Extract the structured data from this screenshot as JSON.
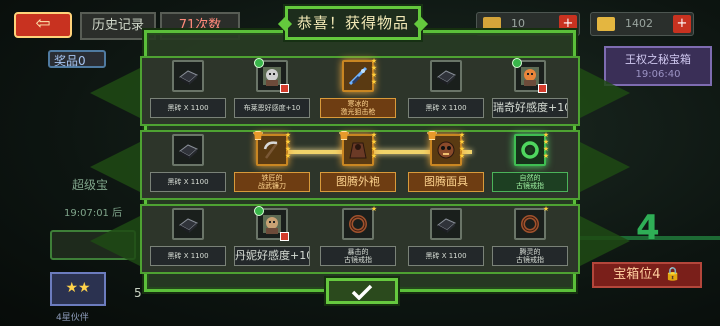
{
  "background": {
    "back_glyph": "⇦",
    "tabs": [
      "历史记录",
      "71次数"
    ],
    "resources": [
      {
        "value": "10",
        "icon": "key-icon",
        "color": "#d4a43a"
      },
      {
        "value": "1402",
        "icon": "gold-bar-icon",
        "color": "#e4b640"
      }
    ],
    "left_labels": [
      "奖品0",
      "超级宝",
      "19:07:01 后"
    ],
    "right_chest_title": "王权之秘宝箱",
    "right_chest_time": "19:06:40",
    "bottom_left_value": "5",
    "bottom_left_caption": "4星伙伴",
    "chest_button": "宝箱位4",
    "big_number": "4"
  },
  "dialog": {
    "title": "恭喜！获得物品",
    "confirm_icon": "checkmark-icon",
    "rows": [
      [
        {
          "label": "黑砖 X 1100",
          "icon": "black-brick-icon",
          "tier": "common",
          "stars": 0
        },
        {
          "label": "布莱恩好感度+10",
          "icon": "hero-brian-portrait-icon",
          "tier": "common",
          "stars": 0,
          "badge": "favor"
        },
        {
          "label": "寒冰的\n激光狙击枪",
          "icon": "laser-sniper-rifle-icon",
          "tier": "rare",
          "stars": 4
        },
        {
          "label": "黑砖 X 1100",
          "icon": "black-brick-icon",
          "tier": "common",
          "stars": 0
        },
        {
          "label": "瑞奇好感度+10",
          "icon": "hero-ricky-fox-portrait-icon",
          "tier": "common",
          "stars": 0,
          "badge": "favor"
        }
      ],
      [
        {
          "label": "黑砖 X 1100",
          "icon": "black-brick-icon",
          "tier": "common",
          "stars": 0
        },
        {
          "label": "铁匠的\n战武镰刀",
          "icon": "scythe-weapon-icon",
          "tier": "rare",
          "stars": 4,
          "badge": "skin"
        },
        {
          "label": "图腾外袍",
          "icon": "totem-robe-icon",
          "tier": "rare",
          "stars": 4,
          "badge": "skin"
        },
        {
          "label": "图腾面具",
          "icon": "totem-mask-icon",
          "tier": "rare",
          "stars": 4,
          "badge": "skin"
        },
        {
          "label": "自然的\n古镜戒指",
          "icon": "green-ring-icon",
          "tier": "epic",
          "stars": 4
        }
      ],
      [
        {
          "label": "黑砖 X 1100",
          "icon": "black-brick-icon",
          "tier": "common",
          "stars": 0
        },
        {
          "label": "丹妮好感度+10",
          "icon": "hero-danni-portrait-icon",
          "tier": "common",
          "stars": 0,
          "badge": "favor"
        },
        {
          "label": "暴击的\n古镜戒指",
          "icon": "bronze-ring-icon",
          "tier": "common",
          "stars": 1
        },
        {
          "label": "黑砖 X 1100",
          "icon": "black-brick-icon",
          "tier": "common",
          "stars": 0
        },
        {
          "label": "腾灵的\n古镜戒指",
          "icon": "bronze-ring-icon",
          "tier": "common",
          "stars": 1
        }
      ]
    ]
  }
}
